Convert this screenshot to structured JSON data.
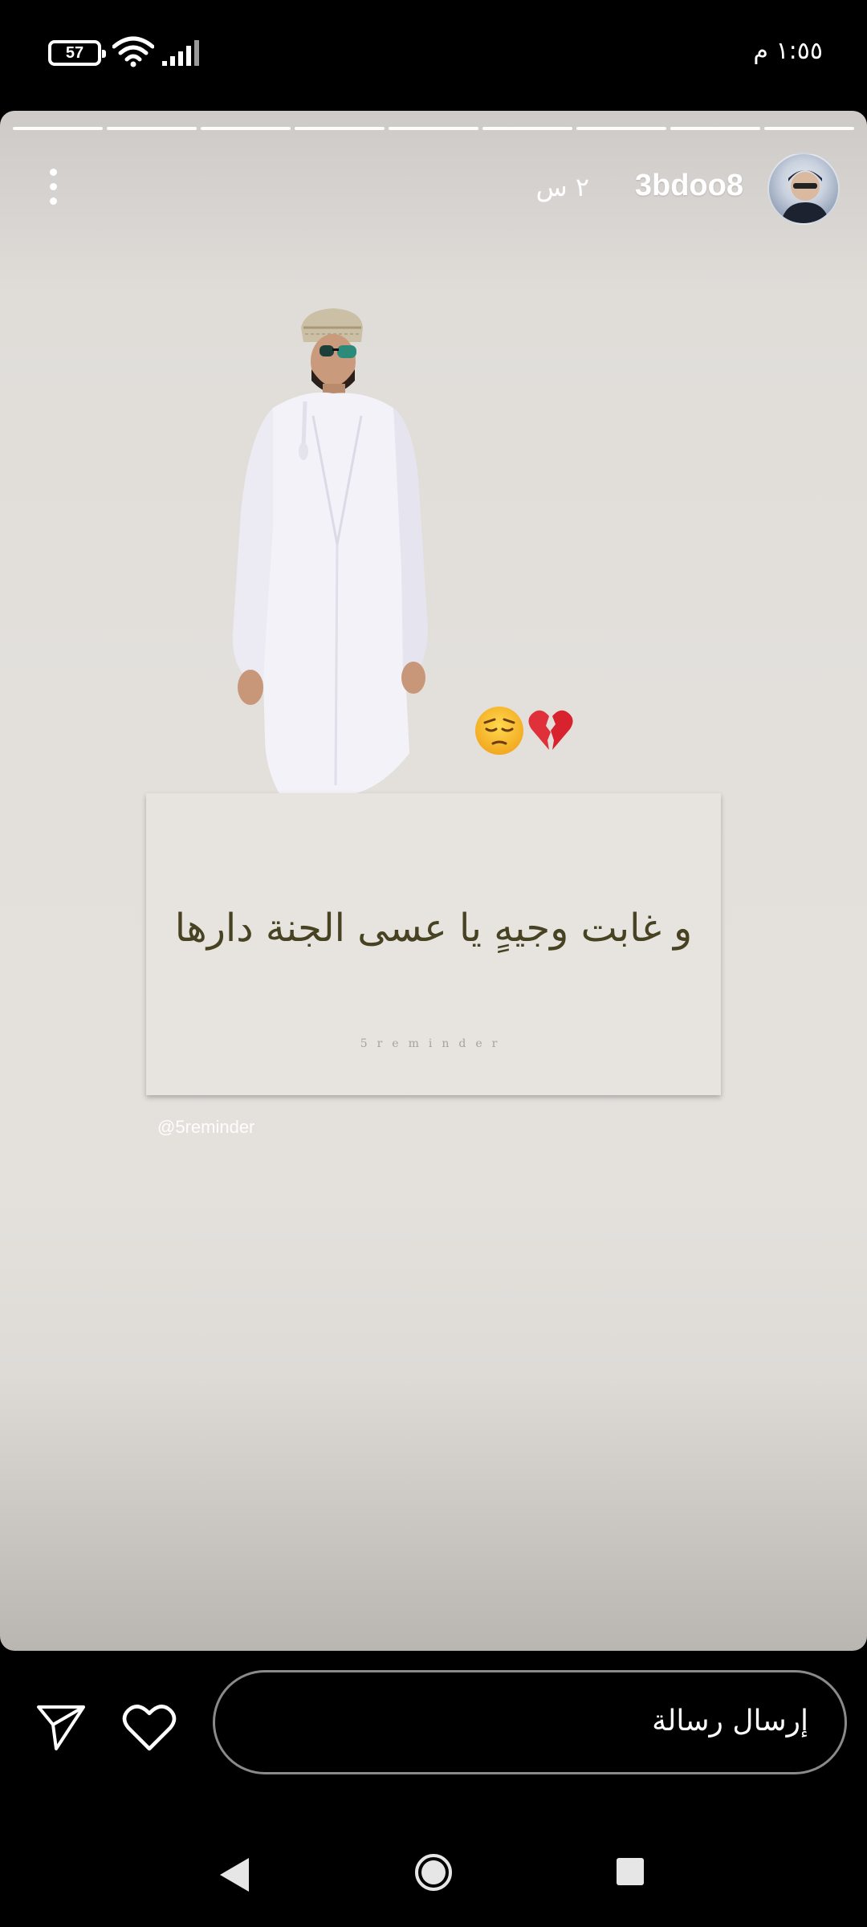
{
  "status_bar": {
    "time": "١:٥٥ م",
    "battery_level": "57",
    "icons": [
      "battery-icon",
      "wifi-icon",
      "cellular-signal-icon"
    ]
  },
  "story": {
    "progress_segments_total": 9,
    "progress_segments_filled": 9,
    "username": "3bdoo8",
    "time_ago": "٢ س",
    "more_icon": "more-vertical-icon",
    "emojis": [
      "😔",
      "💔"
    ],
    "quote": "و غابت وجيهٍ يا عسى الجنة دارها",
    "watermark": "5reminder",
    "mention": "@5reminder"
  },
  "reply_bar": {
    "placeholder": "إرسال رسالة",
    "send_icon": "send-icon",
    "like_icon": "heart-icon"
  },
  "nav_bar": {
    "icons": [
      "back-icon",
      "home-icon",
      "recents-icon"
    ]
  },
  "colors": {
    "quote_text": "#464222",
    "story_background": "#e3e0dc",
    "input_border": "#8a8a8a"
  }
}
